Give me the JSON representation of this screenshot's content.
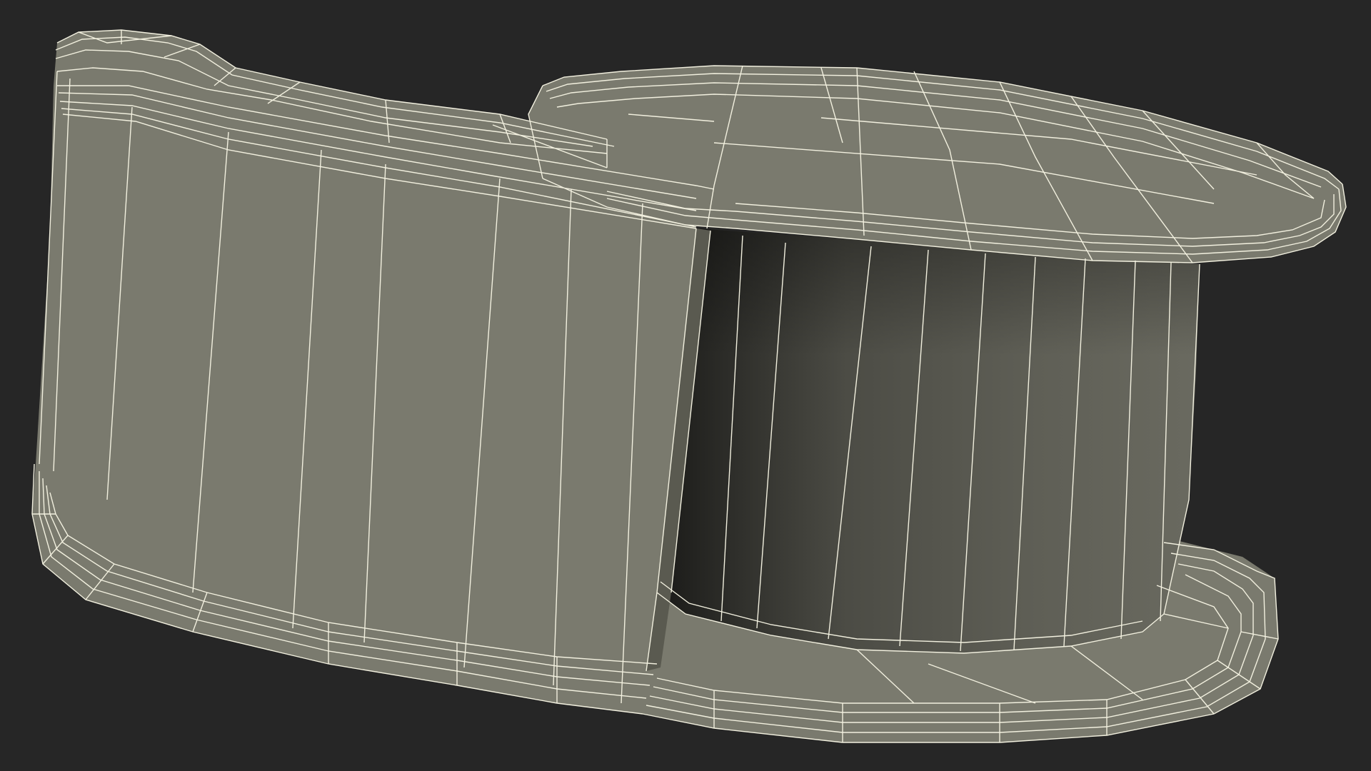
{
  "scene": {
    "subject": "wireframe-3d-model",
    "background_color": "#262626",
    "surface_color": "#7a7a6e",
    "surface_shadow_color": "#1c1c1a",
    "wire_color": "#f2f0df"
  }
}
